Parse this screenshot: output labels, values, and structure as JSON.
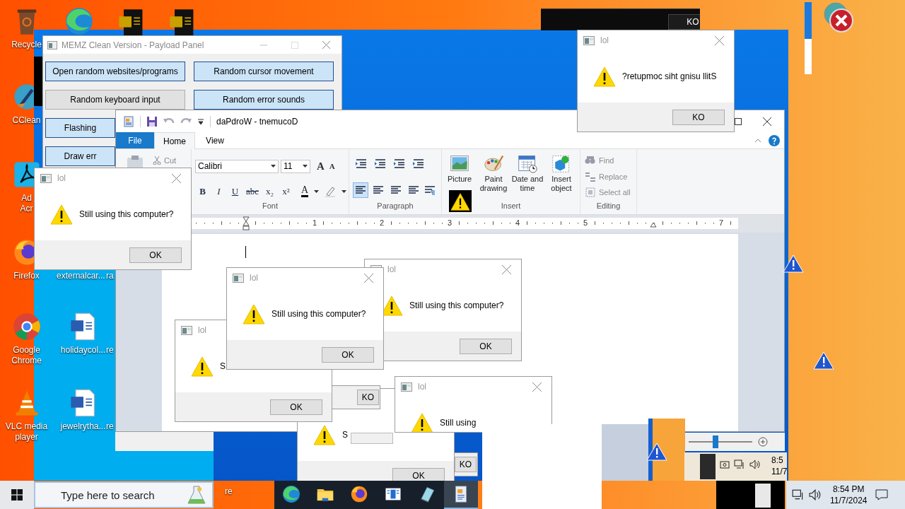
{
  "desktop_icons": [
    {
      "kind": "bin",
      "label": [
        "Recycle"
      ]
    },
    {
      "kind": "edge"
    },
    {
      "kind": "worddoc-dark"
    },
    {
      "kind": "worddoc-dark"
    },
    {
      "kind": "broom",
      "label": [
        "CClean"
      ]
    },
    {
      "kind": "acrobat",
      "label": [
        "Ad",
        "Acr"
      ]
    },
    {
      "kind": "firefox",
      "label": [
        "Firefox"
      ]
    },
    {
      "kind": "hidden",
      "label": [
        "externalcar..."
      ]
    },
    {
      "kind": "hidden",
      "label": [
        "ra"
      ]
    },
    {
      "kind": "chrome",
      "label": [
        "Google",
        "Chrome"
      ]
    },
    {
      "kind": "worddoc",
      "label": [
        "holidaycol..."
      ]
    },
    {
      "kind": "hidden",
      "label": [
        "re"
      ]
    },
    {
      "kind": "vlc",
      "label": [
        "VLC media",
        "player"
      ]
    },
    {
      "kind": "worddoc",
      "label": [
        "jewelrytha..."
      ]
    },
    {
      "kind": "hidden",
      "label": [
        "re"
      ]
    },
    {
      "kind": "hidden",
      "label": [
        "re"
      ]
    }
  ],
  "glitch_window": {
    "button": "KO"
  },
  "payload_panel": {
    "title": "MEMZ Clean Version - Payload Panel",
    "buttons": [
      {
        "label": "Open random websites/programs",
        "on": true
      },
      {
        "label": "Random cursor movement",
        "on": true
      },
      {
        "label": "Random keyboard input",
        "on": false
      },
      {
        "label": "Random error sounds",
        "on": true
      },
      {
        "label": "Flashing",
        "on": true
      },
      {
        "label": "Draw err",
        "on": true
      }
    ]
  },
  "wordpad": {
    "title": "daPdroW - tnemucoD",
    "tabs": [
      {
        "label": "File",
        "kind": "file",
        "selected": false
      },
      {
        "label": "Home",
        "kind": "tab",
        "selected": true
      },
      {
        "label": "View",
        "kind": "tab",
        "selected": false
      }
    ],
    "clipboard": {
      "cut": "Cut"
    },
    "font": {
      "family": "Calibri",
      "size": "11",
      "grow": "A",
      "shrink": "A",
      "format_buttons": [
        "B",
        "I",
        "U",
        "abc",
        "x₂",
        "x²"
      ],
      "color_button": "A",
      "group_label": "Font"
    },
    "paragraph": {
      "alignment": [
        {
          "selected": true
        },
        {
          "selected": false
        },
        {
          "selected": false
        },
        {
          "selected": false
        }
      ],
      "group_label": "Paragraph"
    },
    "insert": {
      "items": [
        {
          "kind": "picture",
          "label": "Picture"
        },
        {
          "kind": "paint",
          "label": "Paint drawing"
        },
        {
          "kind": "calendar",
          "label": "Date and time"
        },
        {
          "kind": "object",
          "label": "Insert object"
        }
      ],
      "group_label": "Insert"
    },
    "editing": {
      "items": [
        {
          "kind": "find",
          "label": "Find",
          "disabled": true
        },
        {
          "kind": "replace",
          "label": "Replace",
          "disabled": true
        },
        {
          "kind": "select",
          "label": "Select all",
          "disabled": true
        }
      ],
      "group_label": "Editing"
    },
    "ruler": [
      "1",
      "2",
      "3",
      "4",
      "5",
      "7"
    ],
    "zoom": {
      "level": 0.42
    }
  },
  "dialogs": [
    {
      "button": "KO"
    },
    {
      "message": "S",
      "button": "OK"
    },
    {
      "button": "KO"
    },
    {
      "title": "lol",
      "message": "S",
      "button": "OK"
    },
    {
      "title": "lol",
      "message": "Still using this computer?",
      "button": "OK"
    },
    {
      "title": "lol",
      "message": "Still using this computer?",
      "button": "OK"
    },
    {
      "title": "lol",
      "message": "Still using"
    },
    {
      "title": "lol",
      "message": "Still using this computer?",
      "button": "OK"
    },
    {
      "title": "lol",
      "message": "?retupmoc siht gnisu llitS",
      "button": "KO"
    }
  ],
  "taskbar": {
    "search_placeholder": "Type here to search",
    "apps": [
      {
        "kind": "edge",
        "selected": false
      },
      {
        "kind": "folder",
        "selected": false
      },
      {
        "kind": "firefox",
        "selected": false
      },
      {
        "kind": "news",
        "selected": false
      },
      {
        "kind": "notepad",
        "selected": false
      },
      {
        "kind": "wordpad",
        "selected": true
      }
    ],
    "time": "8:54 PM",
    "date": "11/7/2024"
  },
  "ghost_tray": {
    "time": "8:5",
    "date": "11/7"
  }
}
